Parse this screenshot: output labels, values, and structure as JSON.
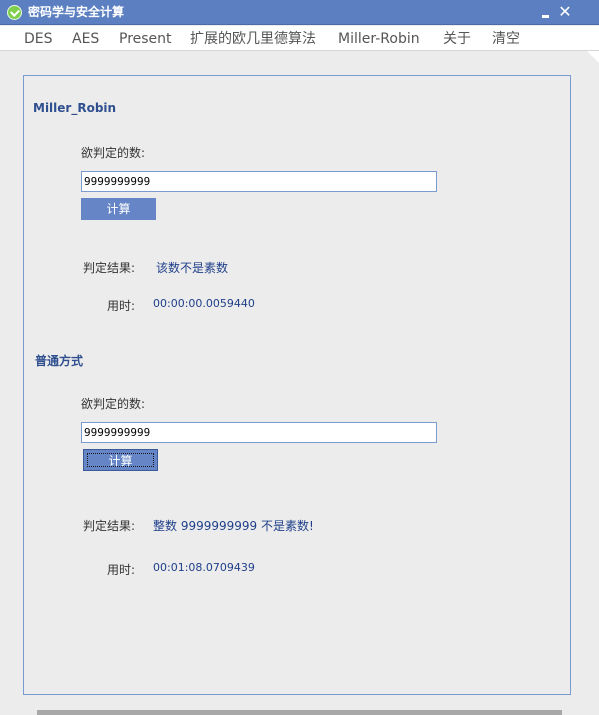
{
  "window": {
    "title": "密码学与安全计算",
    "close_glyph": "✕"
  },
  "menu": [
    "DES",
    "AES",
    "Present",
    "扩展的欧几里德算法",
    "Miller-Robin",
    "关于",
    "清空"
  ],
  "miller": {
    "title": "Miller_Robin",
    "input_label": "欲判定的数:",
    "input_value": "9999999999",
    "button": "计算",
    "result_label": "判定结果:",
    "result_value": "该数不是素数",
    "time_label": "用时:",
    "time_value": "00:00:00.0059440"
  },
  "normal": {
    "title": "普通方式",
    "input_label": "欲判定的数:",
    "input_value": "9999999999",
    "button": "计算",
    "result_label": "判定结果:",
    "result_value": "整数 9999999999 不是素数!",
    "time_label": "用时:",
    "time_value": "00:01:08.0709439"
  },
  "colors": {
    "titlebar": "#5b7fc0",
    "accent": "#6585c7",
    "border": "#7a9bd0",
    "value_text": "#1f3f8a"
  }
}
